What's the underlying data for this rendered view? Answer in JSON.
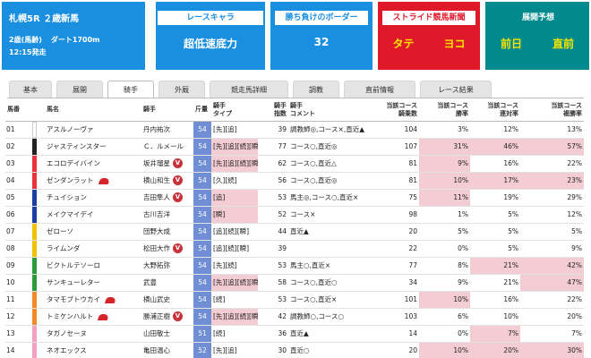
{
  "header": {
    "race_title": "札幌5R ２歳新馬",
    "conditions": [
      "2歳(馬齢)",
      "ダート1700m"
    ],
    "start_time": "12:15発走",
    "race_character_label": "レースキャラ",
    "race_character_value": "超低速底力",
    "borderline_label": "勝ち負けのボーダー",
    "borderline_value": "32",
    "stride_label": "ストライド競馬新聞",
    "stride_values": [
      "タテ",
      "ヨコ"
    ],
    "forecast_label": "展開予想",
    "forecast_values": [
      "前日",
      "直前"
    ]
  },
  "tabs": [
    "基本",
    "展開",
    "騎手",
    "外厩",
    "競走馬詳細",
    "調教",
    "直前情報",
    "レース結果"
  ],
  "active_tab": "騎手",
  "columns": [
    "馬番",
    "馬名",
    "騎手",
    "斤量",
    "騎手\nタイプ",
    "騎手\n指数",
    "騎手\nコメント",
    "当該コース\n騎乗数",
    "当該コース\n勝率",
    "当該コース\n連対率",
    "当該コース\n複勝率"
  ],
  "rows": [
    {
      "no": "01",
      "frame": "#ffffff",
      "horse": "アスルノーヴァ",
      "jockey": "丹内祐次",
      "weight": "54",
      "type": "[先][追]",
      "index": "39",
      "comment": "調教師◎,コース×,直近▲",
      "rides": "104",
      "win": "3%",
      "place": "12%",
      "show": "13%",
      "cap": false,
      "v": false,
      "pink": []
    },
    {
      "no": "02",
      "frame": "#222222",
      "horse": "ジャスティンスター",
      "jockey": "Ｃ．ルメール",
      "weight": "54",
      "type": "[先][追][続][瞬]",
      "index": "77",
      "comment": "コース○,直近◎",
      "rides": "107",
      "win": "31%",
      "place": "46%",
      "show": "57%",
      "cap": false,
      "v": false,
      "pink": [
        "type",
        "win",
        "place",
        "show"
      ]
    },
    {
      "no": "03",
      "frame": "#e8343a",
      "horse": "エコロデイバイン",
      "jockey": "坂井瑠星",
      "weight": "54",
      "type": "[先][追][続][瞬]",
      "index": "62",
      "comment": "コース○,直近△",
      "rides": "81",
      "win": "9%",
      "place": "16%",
      "show": "22%",
      "cap": false,
      "v": true,
      "pink": [
        "type",
        "win"
      ]
    },
    {
      "no": "04",
      "frame": "#e8343a",
      "horse": "ゼンダンラット",
      "jockey": "横山和生",
      "weight": "54",
      "type": "[久][続]",
      "index": "56",
      "comment": "コース○,直近◎",
      "rides": "81",
      "win": "10%",
      "place": "17%",
      "show": "23%",
      "cap": true,
      "v": true,
      "pink": [
        "win",
        "place",
        "show"
      ]
    },
    {
      "no": "05",
      "frame": "#1b3fa0",
      "horse": "チュイション",
      "jockey": "吉田隼人",
      "weight": "54",
      "type": "[追]",
      "index": "53",
      "comment": "馬主◎,コース○,直近×",
      "rides": "75",
      "win": "11%",
      "place": "19%",
      "show": "29%",
      "cap": false,
      "v": true,
      "pink": [
        "type",
        "win"
      ]
    },
    {
      "no": "06",
      "frame": "#1b3fa0",
      "horse": "メイクマイデイ",
      "jockey": "古川吉洋",
      "weight": "54",
      "type": "[瞬]",
      "index": "52",
      "comment": "コース×",
      "rides": "98",
      "win": "1%",
      "place": "5%",
      "show": "12%",
      "cap": false,
      "v": false,
      "pink": [
        "type"
      ]
    },
    {
      "no": "07",
      "frame": "#f2c200",
      "horse": "ゼローソ",
      "jockey": "団野大成",
      "weight": "54",
      "type": "[追][続][瞬]",
      "index": "44",
      "comment": "直近▲",
      "rides": "20",
      "win": "5%",
      "place": "5%",
      "show": "5%",
      "cap": false,
      "v": false,
      "pink": []
    },
    {
      "no": "08",
      "frame": "#f2c200",
      "horse": "ライムンダ",
      "jockey": "松田大作",
      "weight": "54",
      "type": "[追][続][瞬]",
      "index": "39",
      "comment": "",
      "rides": "22",
      "win": "0%",
      "place": "5%",
      "show": "9%",
      "cap": false,
      "v": true,
      "pink": []
    },
    {
      "no": "09",
      "frame": "#2a9a3a",
      "horse": "ビクトルテソーロ",
      "jockey": "大野拓弥",
      "weight": "54",
      "type": "[先][続]",
      "index": "53",
      "comment": "馬主○,直近×",
      "rides": "77",
      "win": "8%",
      "place": "21%",
      "show": "42%",
      "cap": false,
      "v": false,
      "pink": [
        "place",
        "show"
      ]
    },
    {
      "no": "10",
      "frame": "#2a9a3a",
      "horse": "サンキューレター",
      "jockey": "武豊",
      "weight": "54",
      "type": "[先][追][続][瞬]",
      "index": "58",
      "comment": "コース○,直近○",
      "rides": "34",
      "win": "9%",
      "place": "21%",
      "show": "47%",
      "cap": false,
      "v": false,
      "pink": [
        "type",
        "show"
      ]
    },
    {
      "no": "11",
      "frame": "#f0892a",
      "horse": "タマモブトウカイ",
      "jockey": "横山武史",
      "weight": "54",
      "type": "[続]",
      "index": "53",
      "comment": "コース○,直近×",
      "rides": "101",
      "win": "10%",
      "place": "16%",
      "show": "22%",
      "cap": true,
      "v": false,
      "pink": [
        "win"
      ]
    },
    {
      "no": "12",
      "frame": "#f0892a",
      "horse": "トミケンハルト",
      "jockey": "勝浦正樹",
      "weight": "54",
      "type": "[先][追][続][瞬]",
      "index": "42",
      "comment": "調教師○,コース○",
      "rides": "103",
      "win": "6%",
      "place": "10%",
      "show": "20%",
      "cap": true,
      "v": true,
      "pink": [
        "type"
      ]
    },
    {
      "no": "13",
      "frame": "#f5a0c0",
      "horse": "タガノセーヌ",
      "jockey": "山田敬士",
      "weight": "51",
      "type": "[続]",
      "index": "36",
      "comment": "直近▲",
      "rides": "14",
      "win": "0%",
      "place": "7%",
      "show": "7%",
      "cap": false,
      "v": false,
      "pink": [
        "place"
      ]
    },
    {
      "no": "14",
      "frame": "#f5a0c0",
      "horse": "ネオエックス",
      "jockey": "亀田温心",
      "weight": "52",
      "type": "[先][追]",
      "index": "30",
      "comment": "直近○",
      "rides": "20",
      "win": "10%",
      "place": "20%",
      "show": "30%",
      "cap": false,
      "v": false,
      "pink": [
        "win",
        "place",
        "show"
      ]
    }
  ]
}
